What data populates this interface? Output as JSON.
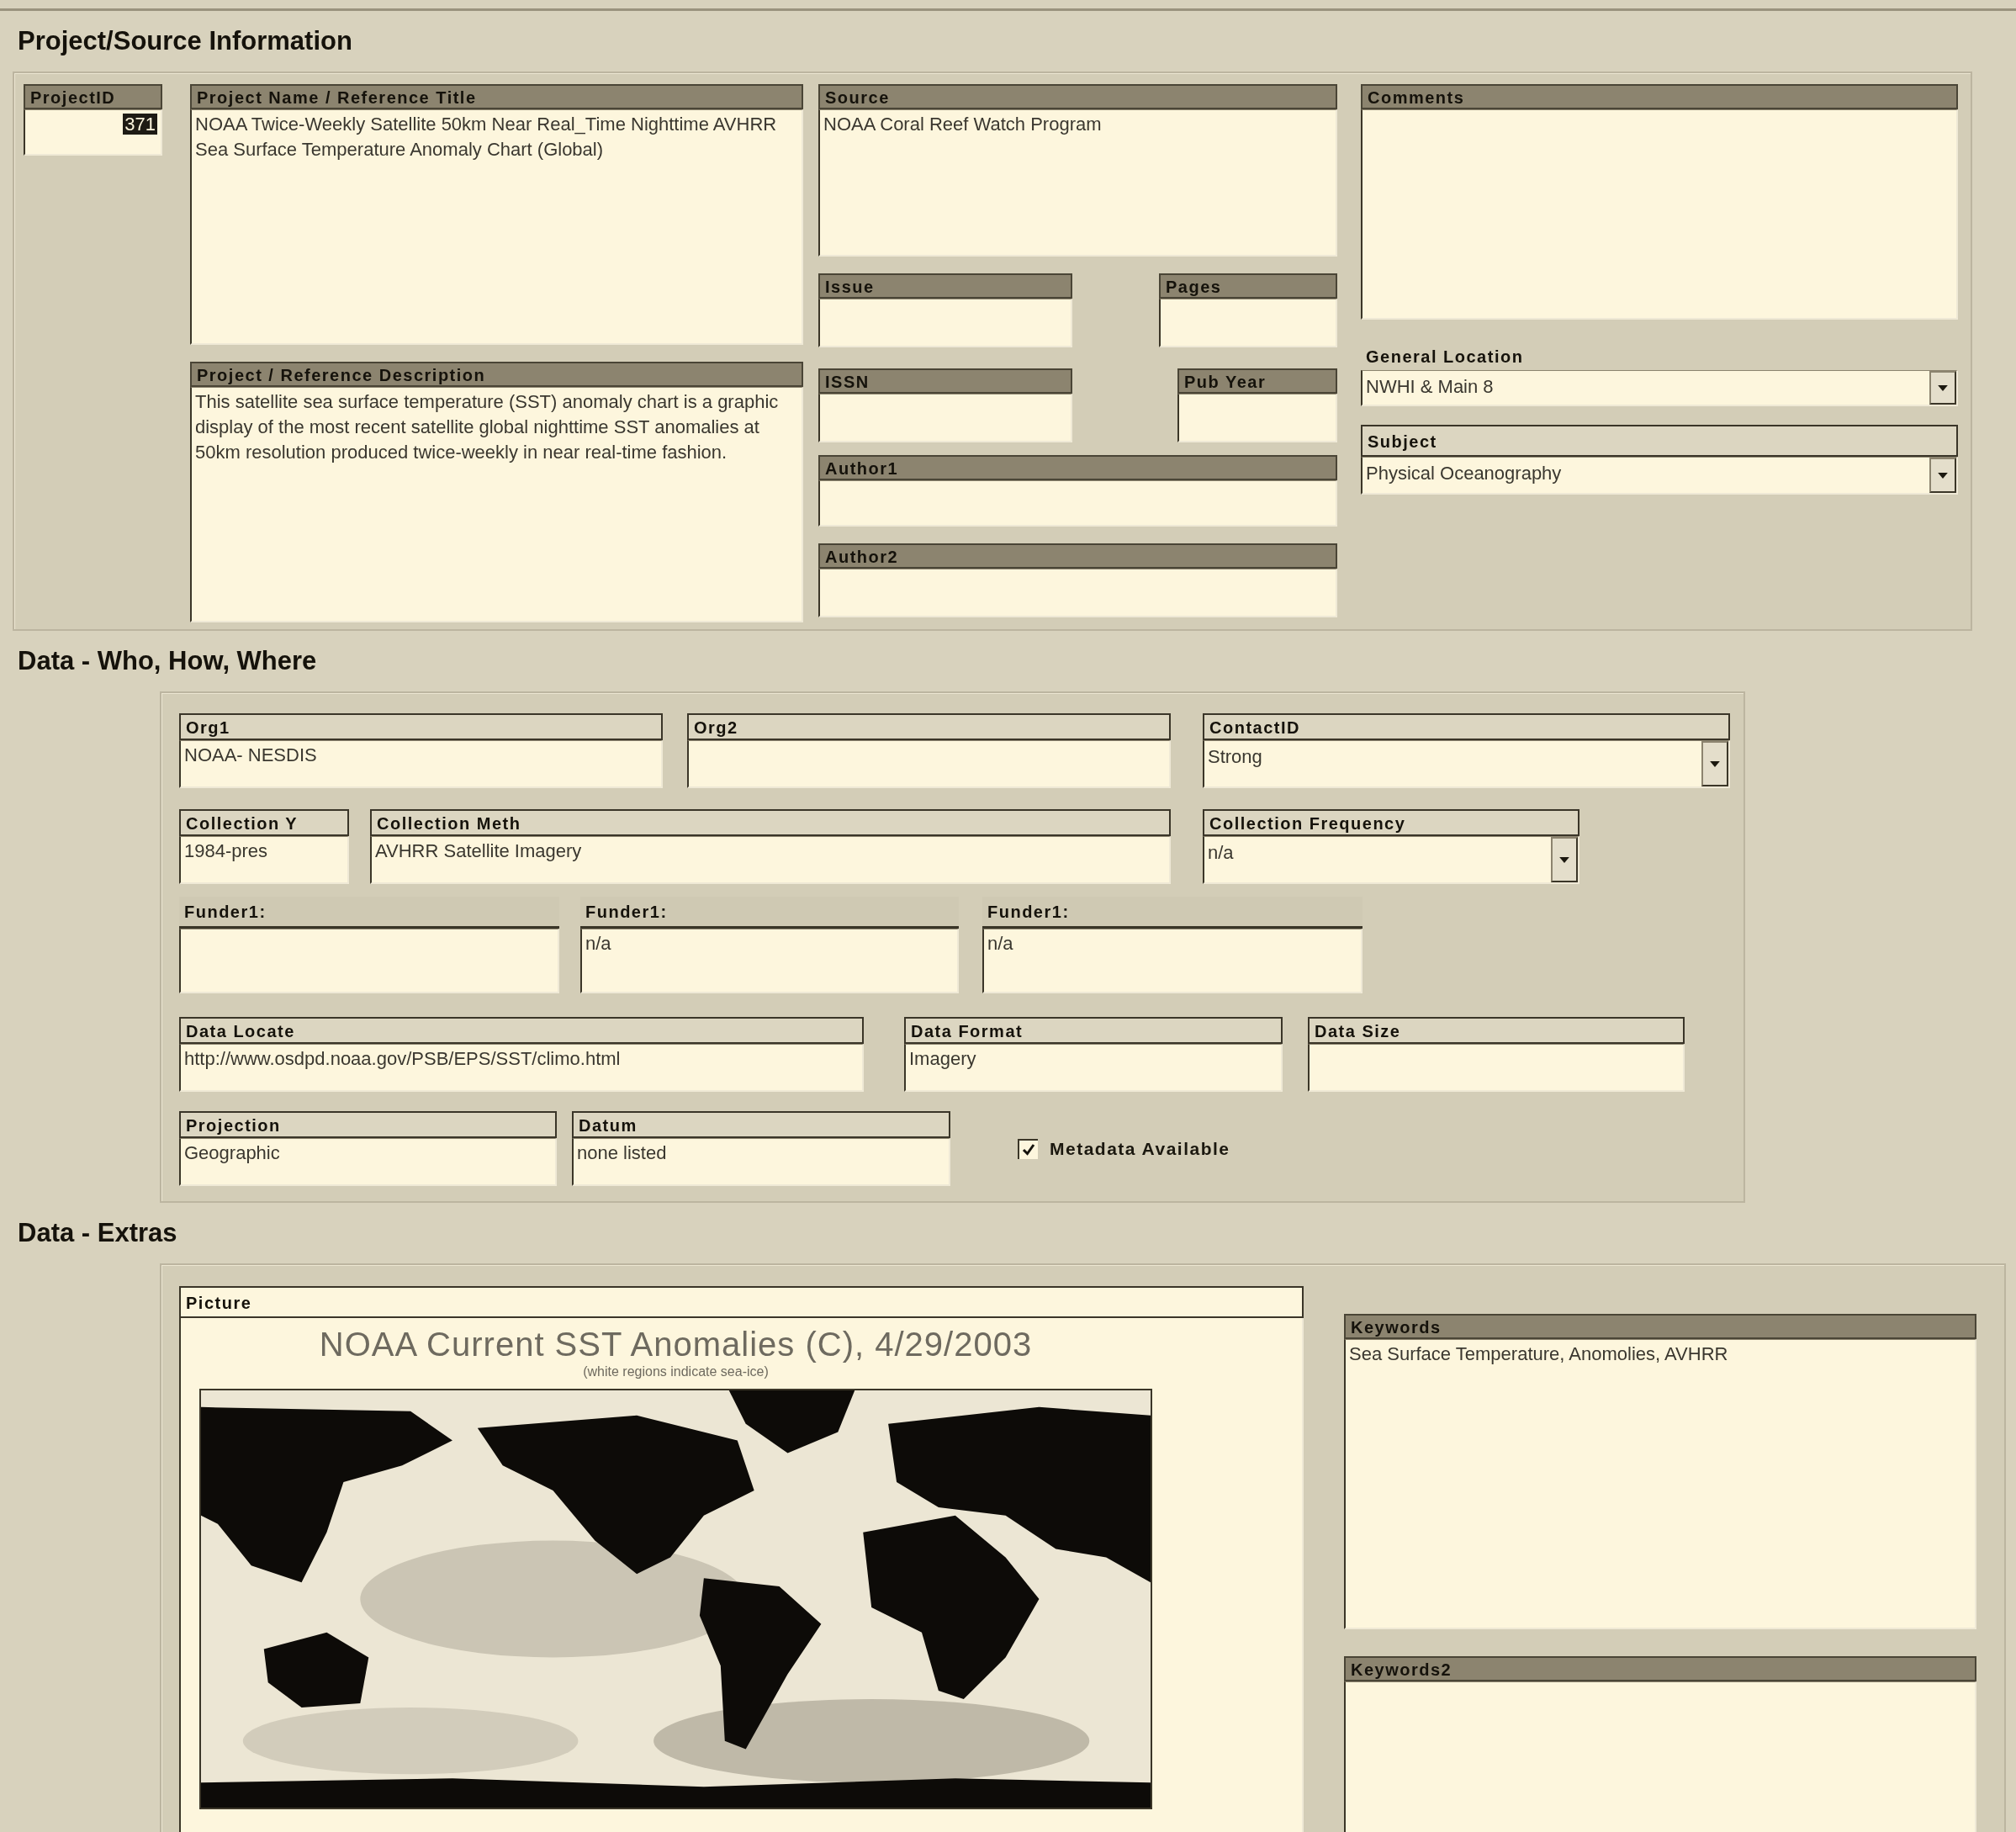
{
  "sections": [
    {
      "title": "Project/Source Information",
      "columns": [
        [
          [
            {
              "kind": "text",
              "label": "ProjectID",
              "value": "371",
              "value_selected": true
            }
          ]
        ],
        [
          [
            {
              "kind": "memo",
              "label": "Project Name / Reference Title",
              "value": "NOAA Twice-Weekly Satellite 50km Near Real_Time Nighttime AVHRR Sea Surface Temperature Anomaly Chart (Global)"
            }
          ],
          [
            {
              "kind": "memo",
              "label": "Project / Reference Description",
              "value": "This satellite sea surface temperature (SST) anomaly chart is a graphic display of the most recent satellite global nighttime SST anomalies at 50km resolution produced twice-weekly in near real-time fashion."
            }
          ]
        ],
        [
          [
            {
              "kind": "memo",
              "label": "Source",
              "value": "NOAA Coral Reef Watch Program"
            }
          ],
          [
            {
              "kind": "text",
              "label": "Issue"
            },
            {
              "kind": "text",
              "label": "Pages"
            }
          ],
          [
            {
              "kind": "text",
              "label": "ISSN"
            },
            {
              "kind": "text",
              "label": "Pub Year"
            }
          ],
          [
            {
              "kind": "text",
              "label": "Author1"
            }
          ],
          [
            {
              "kind": "text",
              "label": "Author2"
            }
          ]
        ],
        [
          [
            {
              "kind": "memo",
              "label": "Comments"
            }
          ],
          [
            {
              "kind": "combo",
              "label": "General Location",
              "value": "NWHI & Main 8"
            }
          ],
          [
            {
              "kind": "combo",
              "label": "Subject",
              "value": "Physical Oceanography"
            }
          ]
        ]
      ]
    },
    {
      "title": "Data - Who, How, Where",
      "columns": [
        [
          [
            {
              "kind": "text",
              "label": "Org1",
              "value": "NOAA- NESDIS"
            },
            {
              "kind": "text",
              "label": "Org2"
            },
            {
              "kind": "combo",
              "label": "ContactID",
              "value": "Strong"
            }
          ],
          [
            {
              "kind": "text",
              "label": "Collection Y",
              "value": "1984-pres"
            },
            {
              "kind": "text",
              "label": "Collection Meth",
              "value": "AVHRR Satellite Imagery"
            },
            {
              "kind": "combo",
              "label": "Collection Frequency",
              "value": "n/a"
            }
          ],
          [
            {
              "kind": "memo",
              "label": "Funder1:"
            },
            {
              "kind": "memo",
              "label": "Funder1:",
              "value": "n/a"
            },
            {
              "kind": "memo",
              "label": "Funder1:",
              "value": "n/a"
            }
          ],
          [
            {
              "kind": "text",
              "label": "Data Locate",
              "value": "http://www.osdpd.noaa.gov/PSB/EPS/SST/climo.html"
            },
            {
              "kind": "text",
              "label": "Data Format",
              "value": "Imagery"
            },
            {
              "kind": "text",
              "label": "Data Size"
            }
          ],
          [
            {
              "kind": "text",
              "label": "Projection",
              "value": "Geographic"
            },
            {
              "kind": "text",
              "label": "Datum",
              "value": "none listed"
            },
            {
              "kind": "checkbox",
              "label": "Metadata Available",
              "checked": true
            }
          ]
        ]
      ]
    },
    {
      "title": "Data - Extras",
      "columns": [
        [
          [
            {
              "kind": "picture",
              "label": "Picture",
              "title": "NOAA Current SST Anomalies (C), 4/29/2003",
              "subtitle": "(white regions indicate sea-ice)"
            }
          ]
        ],
        [
          [
            {
              "kind": "memo",
              "label": "Keywords",
              "value": "Sea Surface Temperature, Anomolies, AVHRR"
            }
          ],
          [
            {
              "kind": "memo",
              "label": "Keywords2"
            }
          ]
        ]
      ]
    }
  ]
}
